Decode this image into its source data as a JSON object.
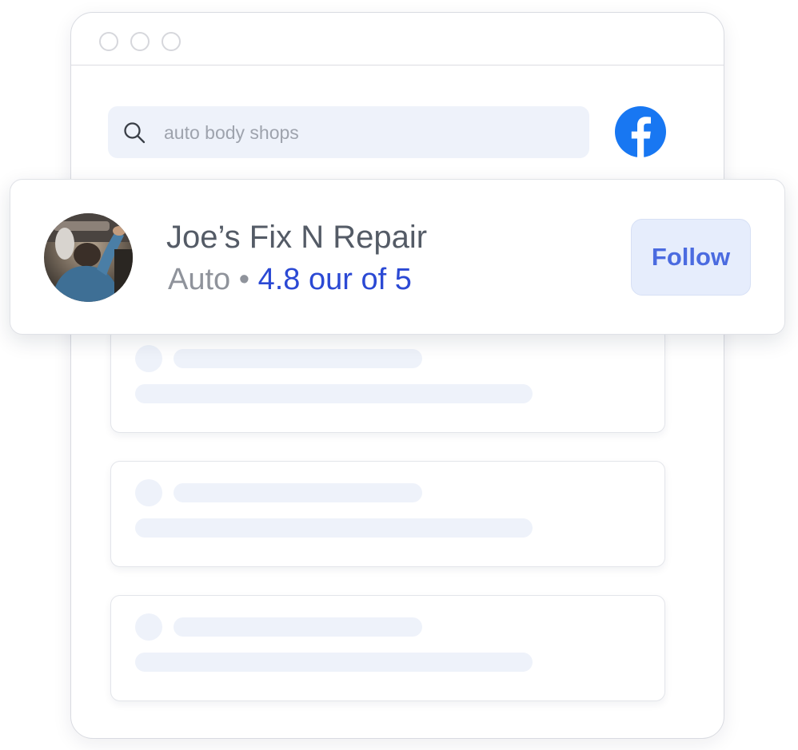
{
  "search": {
    "query": "auto body shops"
  },
  "icons": {
    "search": "search-icon",
    "brand": "facebook-logo-icon",
    "window_controls": [
      "window-dot-icon",
      "window-dot-icon",
      "window-dot-icon"
    ]
  },
  "result": {
    "name": "Joe’s Fix N Repair",
    "category": "Auto",
    "separator": "•",
    "rating_text": "4.8 our of 5",
    "follow_label": "Follow"
  },
  "colors": {
    "brand_facebook": "#1877F2",
    "rating_blue": "#2B49D4",
    "follow_text": "#4B6BE0",
    "follow_bg": "#E6EDFC",
    "skeleton": "#EEF2FA"
  },
  "skeleton_cards": [
    {
      "placeholder": true
    },
    {
      "placeholder": true
    },
    {
      "placeholder": true
    }
  ]
}
